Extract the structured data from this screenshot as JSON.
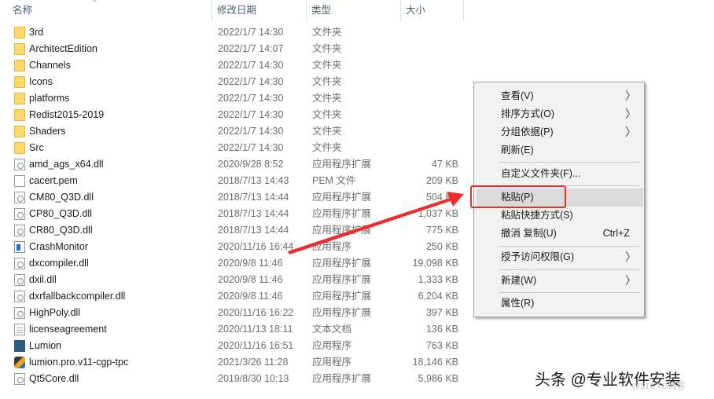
{
  "header": {
    "columns": [
      {
        "label": "名称"
      },
      {
        "label": "修改日期"
      },
      {
        "label": "类型"
      },
      {
        "label": "大小"
      }
    ],
    "sort_indicator": "^"
  },
  "files": [
    {
      "name": "3rd",
      "date": "2022/1/7 14:30",
      "type": "文件夹",
      "size": "",
      "icon": "folder-icon"
    },
    {
      "name": "ArchitectEdition",
      "date": "2022/1/7 14:07",
      "type": "文件夹",
      "size": "",
      "icon": "folder-icon"
    },
    {
      "name": "Channels",
      "date": "2022/1/7 14:30",
      "type": "文件夹",
      "size": "",
      "icon": "folder-icon"
    },
    {
      "name": "Icons",
      "date": "2022/1/7 14:30",
      "type": "文件夹",
      "size": "",
      "icon": "folder-icon"
    },
    {
      "name": "platforms",
      "date": "2022/1/7 14:30",
      "type": "文件夹",
      "size": "",
      "icon": "folder-icon"
    },
    {
      "name": "Redist2015-2019",
      "date": "2022/1/7 14:30",
      "type": "文件夹",
      "size": "",
      "icon": "folder-icon"
    },
    {
      "name": "Shaders",
      "date": "2022/1/7 14:30",
      "type": "文件夹",
      "size": "",
      "icon": "folder-icon"
    },
    {
      "name": "Src",
      "date": "2022/1/7 14:30",
      "type": "文件夹",
      "size": "",
      "icon": "folder-icon"
    },
    {
      "name": "amd_ags_x64.dll",
      "date": "2020/9/28 8:52",
      "type": "应用程序扩展",
      "size": "47 KB",
      "icon": "dll-file-icon"
    },
    {
      "name": "cacert.pem",
      "date": "2018/7/13 14:43",
      "type": "PEM 文件",
      "size": "209 KB",
      "icon": "blank-file-icon"
    },
    {
      "name": "CM80_Q3D.dll",
      "date": "2018/7/13 14:44",
      "type": "应用程序扩展",
      "size": "504 KB",
      "icon": "dll-file-icon"
    },
    {
      "name": "CP80_Q3D.dll",
      "date": "2018/7/13 14:44",
      "type": "应用程序扩展",
      "size": "1,037 KB",
      "icon": "dll-file-icon"
    },
    {
      "name": "CR80_Q3D.dll",
      "date": "2018/7/13 14:44",
      "type": "应用程序扩展",
      "size": "775 KB",
      "icon": "dll-file-icon"
    },
    {
      "name": "CrashMonitor",
      "date": "2020/11/16 16:44",
      "type": "应用程序",
      "size": "250 KB",
      "icon": "application-icon"
    },
    {
      "name": "dxcompiler.dll",
      "date": "2020/9/8 11:46",
      "type": "应用程序扩展",
      "size": "19,098 KB",
      "icon": "dll-file-icon"
    },
    {
      "name": "dxil.dll",
      "date": "2020/9/8 11:46",
      "type": "应用程序扩展",
      "size": "1,333 KB",
      "icon": "dll-file-icon"
    },
    {
      "name": "dxrfallbackcompiler.dll",
      "date": "2020/9/8 11:46",
      "type": "应用程序扩展",
      "size": "6,204 KB",
      "icon": "dll-file-icon"
    },
    {
      "name": "HighPoly.dll",
      "date": "2020/11/16 16:22",
      "type": "应用程序扩展",
      "size": "397 KB",
      "icon": "dll-file-icon"
    },
    {
      "name": "licenseagreement",
      "date": "2020/11/13 18:11",
      "type": "文本文档",
      "size": "136 KB",
      "icon": "text-file-icon"
    },
    {
      "name": "Lumion",
      "date": "2020/11/16 16:51",
      "type": "应用程序",
      "size": "763 KB",
      "icon": "lumion-app-icon"
    },
    {
      "name": "lumion.pro.v11-cgp-tpc",
      "date": "2021/3/26 11:28",
      "type": "应用程序",
      "size": "18,146 KB",
      "icon": "crack-app-icon"
    },
    {
      "name": "Qt5Core.dll",
      "date": "2019/8/30 10:13",
      "type": "应用程序扩展",
      "size": "5,986 KB",
      "icon": "dll-file-icon"
    }
  ],
  "context_menu": {
    "items": [
      {
        "label": "查看(V)",
        "submenu": true
      },
      {
        "label": "排序方式(O)",
        "submenu": true
      },
      {
        "label": "分组依据(P)",
        "submenu": true
      },
      {
        "label": "刷新(E)"
      },
      {
        "label": "自定义文件夹(F)..."
      },
      {
        "label": "粘贴(P)",
        "highlighted": true
      },
      {
        "label": "粘贴快捷方式(S)"
      },
      {
        "label": "撤消 复制(U)",
        "shortcut": "Ctrl+Z"
      },
      {
        "label": "授予访问权限(G)",
        "submenu": true
      },
      {
        "label": "新建(W)",
        "submenu": true
      },
      {
        "label": "属性(R)"
      }
    ],
    "submenu_glyph": "〉"
  },
  "annotation": {
    "color": "#ef2c2c",
    "highlight_target": "粘贴(P)"
  },
  "watermark": {
    "text": "头条 @专业软件安装",
    "subtext": "@51CTO博客"
  }
}
